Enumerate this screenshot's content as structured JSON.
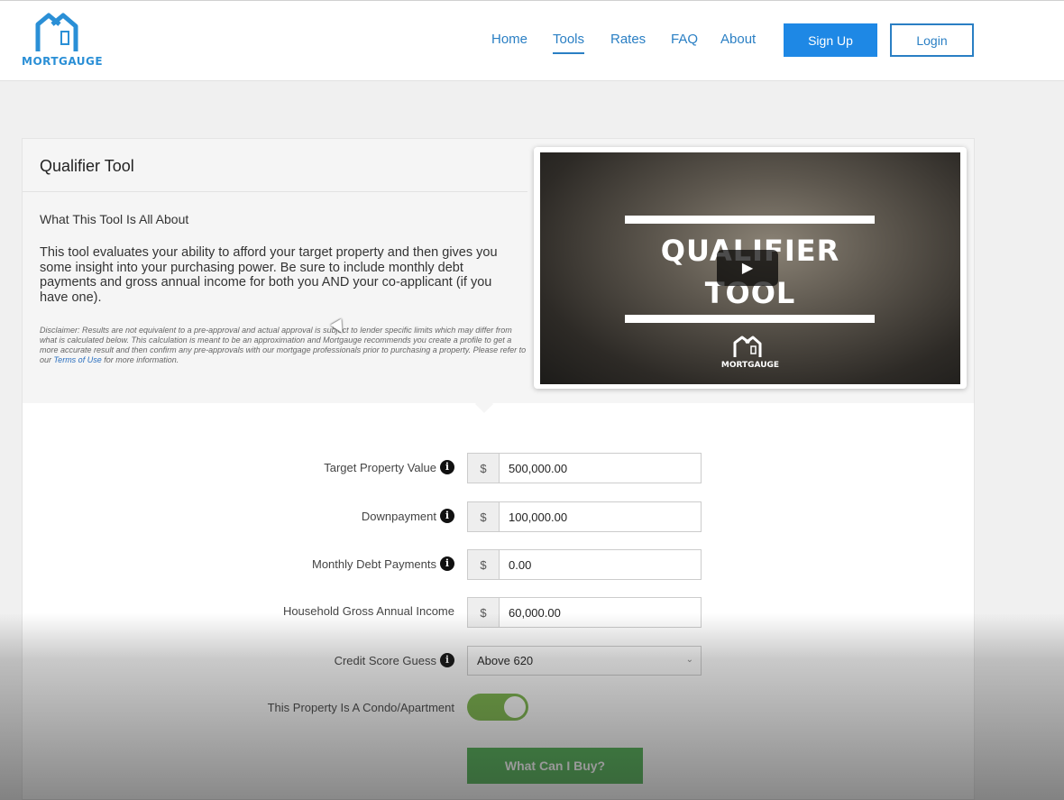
{
  "brand": {
    "logo_text": "MORTGAUGE",
    "accent": "#2a8fd6"
  },
  "nav": {
    "items": [
      "Home",
      "Tools",
      "Rates",
      "FAQ",
      "About"
    ],
    "active": "Tools",
    "signup_label": "Sign Up",
    "login_label": "Login"
  },
  "tool": {
    "title": "Qualifier Tool",
    "about_heading": "What This Tool Is All About",
    "about_body": "This tool evaluates your ability to afford your target property and then gives you some insight into your purchasing power. Be sure to include monthly debt payments and gross annual income for both you AND your co-applicant (if you have one).",
    "disclaimer_pre": "Disclaimer: Results are not equivalent to a pre-approval and actual approval is subject to lender specific limits which may differ from what is calculated below. This calculation is meant to be an approximation and Mortgauge recommends you create a profile to get a more accurate result and then confirm any pre-approvals with our mortgage professionals prior to purchasing a property. Please refer to our ",
    "disclaimer_link": "Terms of Use",
    "disclaimer_post": " for more information."
  },
  "video": {
    "title_line1": "QUALIFIER",
    "title_line2": "TOOL",
    "logo_text": "MORTGAUGE"
  },
  "form": {
    "currency_symbol": "$",
    "fields": [
      {
        "label": "Target Property Value",
        "value": "500,000.00",
        "info": true
      },
      {
        "label": "Downpayment",
        "value": "100,000.00",
        "info": true
      },
      {
        "label": "Monthly Debt Payments",
        "value": "0.00",
        "info": true
      },
      {
        "label": "Household Gross Annual Income",
        "value": "60,000.00",
        "info": false
      }
    ],
    "credit_label": "Credit Score Guess",
    "credit_value": "Above 620",
    "condo_label": "This Property Is A Condo/Apartment",
    "condo_on": true,
    "submit_label": "What Can I Buy?"
  }
}
